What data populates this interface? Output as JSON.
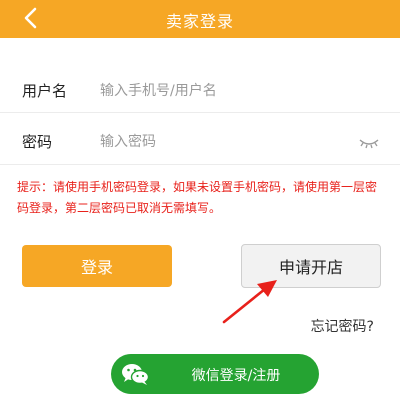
{
  "header": {
    "title": "卖家登录",
    "back_icon": "chevron-left-icon",
    "color": "#f6a725"
  },
  "form": {
    "username": {
      "label": "用户名",
      "placeholder": "输入手机号/用户名",
      "value": ""
    },
    "password": {
      "label": "密码",
      "placeholder": "输入密码",
      "value": "",
      "toggle_icon": "eye-closed-icon"
    }
  },
  "hint": "提示：请使用手机密码登录，如果未设置手机密码，请使用第一层密码登录，第二层密码已取消无需填写。",
  "buttons": {
    "login": "登录",
    "open_shop": "申请开店",
    "forgot_password": "忘记密码?",
    "wechat_login": "微信登录/注册"
  },
  "colors": {
    "accent": "#f6a725",
    "hint": "#e8211b",
    "wechat": "#25a332",
    "annotation_arrow": "#e8211b"
  }
}
